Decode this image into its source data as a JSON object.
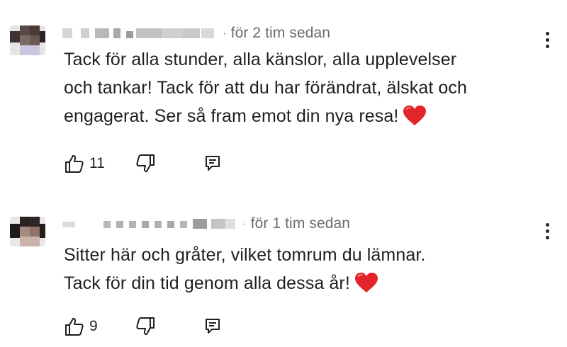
{
  "comments": [
    {
      "author": "",
      "timestamp": "för 2 tim sedan",
      "lines": [
        "Tack för alla stunder, alla känslor, alla upplevelser",
        "och tankar! Tack för att du har förändrat, älskat och",
        "engagerat. Ser så fram emot din nya resa!"
      ],
      "emoji": "red-heart-icon",
      "likes": "11"
    },
    {
      "author": "",
      "timestamp": "för 1 tim sedan",
      "lines": [
        "Sitter här och gråter, vilket tomrum du lämnar.",
        "Tack för din tid genom alla dessa år!"
      ],
      "emoji": "red-heart-icon",
      "likes": "9"
    }
  ],
  "icons": {
    "like": "thumb-up-icon",
    "dislike": "thumb-down-icon",
    "reply": "reply-comment-icon",
    "menu": "more-vertical-icon"
  },
  "colors": {
    "text": "#1f1f1f",
    "secondary_text": "#6b6b6b",
    "heart": "#e3242b"
  }
}
